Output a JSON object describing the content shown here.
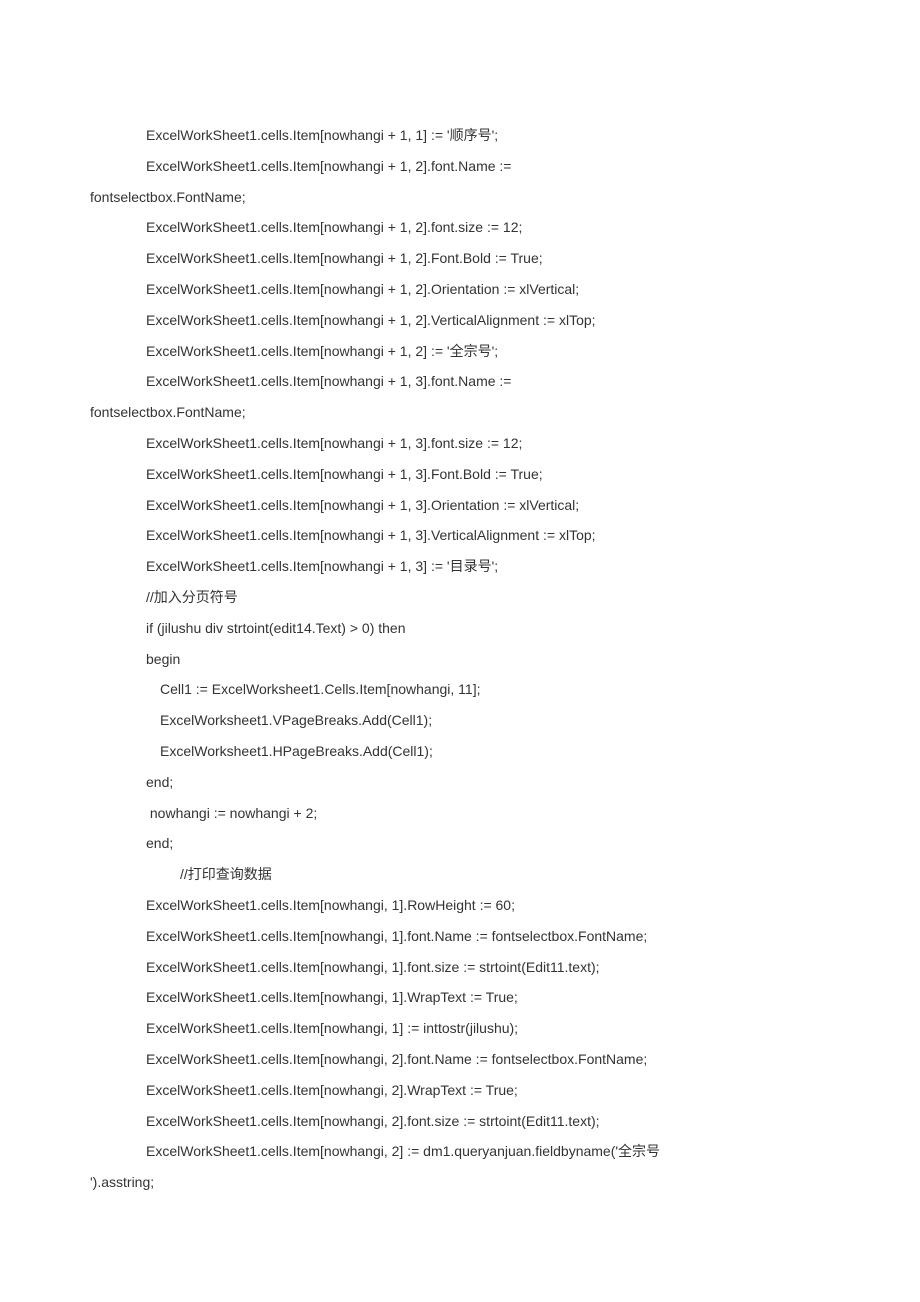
{
  "lines": [
    {
      "indent": "indent-1",
      "text": "ExcelWorkSheet1.cells.Item[nowhangi + 1, 1] := '顺序号';"
    },
    {
      "indent": "indent-1",
      "text": "ExcelWorkSheet1.cells.Item[nowhangi + 1, 2].font.Name :="
    },
    {
      "indent": "no-indent",
      "text": "fontselectbox.FontName;"
    },
    {
      "indent": "indent-1",
      "text": "ExcelWorkSheet1.cells.Item[nowhangi + 1, 2].font.size := 12;"
    },
    {
      "indent": "indent-1",
      "text": "ExcelWorkSheet1.cells.Item[nowhangi + 1, 2].Font.Bold := True;"
    },
    {
      "indent": "indent-1",
      "text": "ExcelWorkSheet1.cells.Item[nowhangi + 1, 2].Orientation := xlVertical;"
    },
    {
      "indent": "indent-1",
      "text": "ExcelWorkSheet1.cells.Item[nowhangi + 1, 2].VerticalAlignment := xlTop;"
    },
    {
      "indent": "indent-1",
      "text": "ExcelWorkSheet1.cells.Item[nowhangi + 1, 2] := '全宗号';"
    },
    {
      "indent": "indent-1",
      "text": "ExcelWorkSheet1.cells.Item[nowhangi + 1, 3].font.Name :="
    },
    {
      "indent": "no-indent",
      "text": "fontselectbox.FontName;"
    },
    {
      "indent": "indent-1",
      "text": "ExcelWorkSheet1.cells.Item[nowhangi + 1, 3].font.size := 12;"
    },
    {
      "indent": "indent-1",
      "text": "ExcelWorkSheet1.cells.Item[nowhangi + 1, 3].Font.Bold := True;"
    },
    {
      "indent": "indent-1",
      "text": "ExcelWorkSheet1.cells.Item[nowhangi + 1, 3].Orientation := xlVertical;"
    },
    {
      "indent": "indent-1",
      "text": "ExcelWorkSheet1.cells.Item[nowhangi + 1, 3].VerticalAlignment := xlTop;"
    },
    {
      "indent": "indent-1",
      "text": "ExcelWorkSheet1.cells.Item[nowhangi + 1, 3] := '目录号';"
    },
    {
      "indent": "indent-1",
      "text": "//加入分页符号"
    },
    {
      "indent": "indent-1",
      "text": "if (jilushu div strtoint(edit14.Text) > 0) then"
    },
    {
      "indent": "indent-1",
      "text": "begin"
    },
    {
      "indent": "indent-2",
      "text": "Cell1 := ExcelWorksheet1.Cells.Item[nowhangi, 11];"
    },
    {
      "indent": "indent-2",
      "text": "ExcelWorksheet1.VPageBreaks.Add(Cell1);"
    },
    {
      "indent": "indent-2",
      "text": "ExcelWorksheet1.HPageBreaks.Add(Cell1);"
    },
    {
      "indent": "indent-1",
      "text": "end;"
    },
    {
      "indent": "indent-1",
      "text": " nowhangi := nowhangi + 2;"
    },
    {
      "indent": "indent-1",
      "text": "end;"
    },
    {
      "indent": "indent-3",
      "text": "//打印查询数据"
    },
    {
      "indent": "indent-1",
      "text": "ExcelWorkSheet1.cells.Item[nowhangi, 1].RowHeight := 60;"
    },
    {
      "indent": "indent-1",
      "text": "ExcelWorkSheet1.cells.Item[nowhangi, 1].font.Name := fontselectbox.FontName;"
    },
    {
      "indent": "indent-1",
      "text": "ExcelWorkSheet1.cells.Item[nowhangi, 1].font.size := strtoint(Edit11.text);"
    },
    {
      "indent": "indent-1",
      "text": "ExcelWorkSheet1.cells.Item[nowhangi, 1].WrapText := True;"
    },
    {
      "indent": "indent-1",
      "text": "ExcelWorkSheet1.cells.Item[nowhangi, 1] := inttostr(jilushu);"
    },
    {
      "indent": "indent-1",
      "text": "ExcelWorkSheet1.cells.Item[nowhangi, 2].font.Name := fontselectbox.FontName;"
    },
    {
      "indent": "indent-1",
      "text": "ExcelWorkSheet1.cells.Item[nowhangi, 2].WrapText := True;"
    },
    {
      "indent": "indent-1",
      "text": "ExcelWorkSheet1.cells.Item[nowhangi, 2].font.size := strtoint(Edit11.text);"
    },
    {
      "indent": "indent-1",
      "text": "ExcelWorkSheet1.cells.Item[nowhangi, 2] := dm1.queryanjuan.fieldbyname('全宗号"
    },
    {
      "indent": "no-indent",
      "text": "').asstring;"
    }
  ]
}
